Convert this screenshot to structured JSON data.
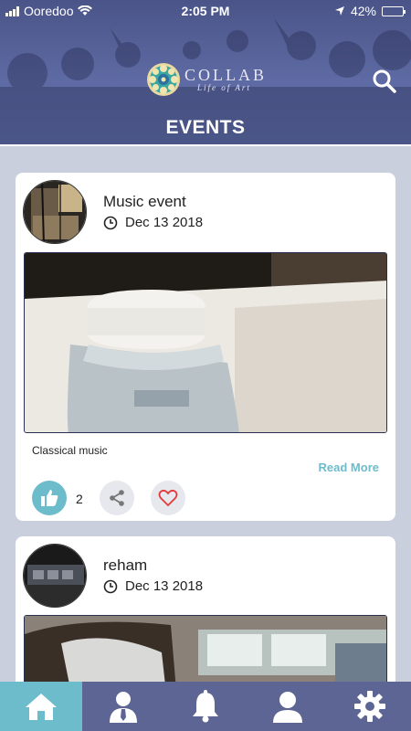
{
  "status_bar": {
    "carrier": "Ooredoo",
    "time": "2:05 PM",
    "battery": "42%",
    "battery_level": 0.42,
    "icons": [
      "signal-icon",
      "wifi-icon",
      "location-arrow-icon",
      "battery-icon"
    ]
  },
  "header": {
    "logo_title": "COLLAB",
    "logo_subtitle": "Life of Art",
    "page_title": "EVENTS",
    "search_icon": "search-icon"
  },
  "events": [
    {
      "title": "Music event",
      "date": "Dec 13 2018",
      "description": "Classical music",
      "read_more": "Read More",
      "likes": "2",
      "image": "photo of a water bottle cap"
    },
    {
      "title": "reham",
      "date": "Dec 13 2018"
    }
  ],
  "bottom_nav": {
    "items": [
      "home-icon",
      "person-tie-icon",
      "bell-icon",
      "user-icon",
      "gear-icon"
    ],
    "active": "home-icon"
  },
  "colors": {
    "header": "#5e6aa3",
    "accent": "#6cbccc",
    "nav": "#5c6593",
    "background": "#c9cfdd",
    "battery": "#ffd21f"
  }
}
